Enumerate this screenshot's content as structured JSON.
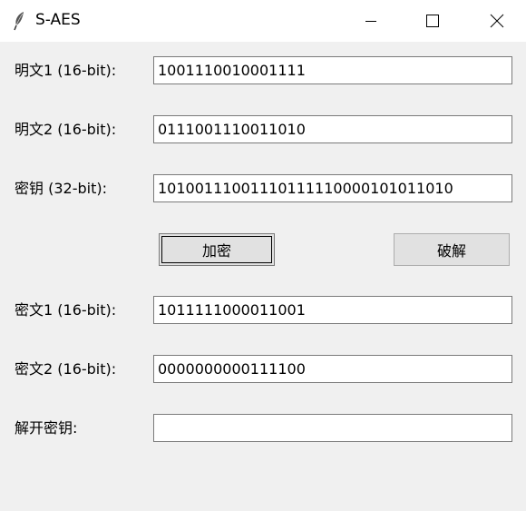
{
  "window": {
    "title": "S-AES"
  },
  "form": {
    "plaintext1_label": "明文1 (16-bit):",
    "plaintext1_value": "1001110010001111",
    "plaintext2_label": "明文2 (16-bit):",
    "plaintext2_value": "0111001110011010",
    "key_label": "密钥 (32-bit):",
    "key_value": "10100111001110111110000101011010",
    "encrypt_label": "加密",
    "crack_label": "破解",
    "ciphertext1_label": "密文1 (16-bit):",
    "ciphertext1_value": "1011111000011001",
    "ciphertext2_label": "密文2 (16-bit):",
    "ciphertext2_value": "0000000000111100",
    "cracked_key_label": "解开密钥:",
    "cracked_key_value": ""
  },
  "icons": {
    "app": "feather-icon",
    "minimize": "minimize-icon",
    "maximize": "maximize-icon",
    "close": "close-icon"
  }
}
